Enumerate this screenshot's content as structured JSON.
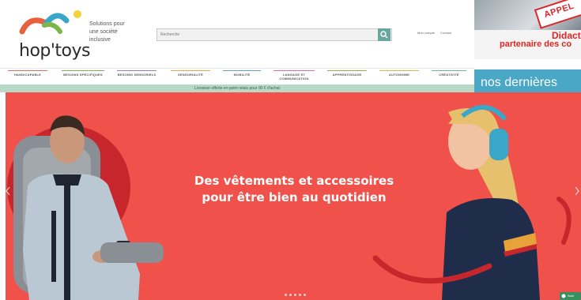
{
  "brand": {
    "logo_text": "hop'toys",
    "tagline": [
      "Solutions pour",
      "une société",
      "inclusive"
    ]
  },
  "search": {
    "placeholder": "Recherche"
  },
  "top_links": [
    "Mon compte",
    "Contact"
  ],
  "nav": {
    "items": [
      {
        "label": "HANDICAPABLE",
        "color": "#e66d5a"
      },
      {
        "label": "BESOINS SPÉCIFIQUES",
        "color": "#7fb35a"
      },
      {
        "label": "BESOINS SENSORIELS",
        "color": "#9e7cc1"
      },
      {
        "label": "SENSORIALITÉ",
        "color": "#e8a54b"
      },
      {
        "label": "MOBILITÉ",
        "color": "#5aa8c9"
      },
      {
        "label": "LANGAGE ET COMMUNICATION",
        "color": "#e66d8d"
      },
      {
        "label": "APPRENTISSAGE",
        "color": "#8fb54a"
      },
      {
        "label": "AUTONOMIE",
        "color": "#d9b64a"
      },
      {
        "label": "CRÉATIVITÉ",
        "color": "#6fb6a6"
      }
    ]
  },
  "promo": {
    "text": "Livraison offerte en point relais pour 90 € d'achat"
  },
  "ad": {
    "sign": "APPEL",
    "title_line1": "Didacto",
    "title_line2": "partenaire des co"
  },
  "right_banner": {
    "text": "nos dernières"
  },
  "hero": {
    "headline_line1": "Des vêtements et accessoires",
    "headline_line2": "pour être bien  au quotidien",
    "background": "#f0514a",
    "active_slide": 1,
    "slide_count": 5
  },
  "chat": {
    "label": "Aide"
  },
  "colors": {
    "accent": "#6aa6a0",
    "promo": "#b9d9c8",
    "brand_red": "#e3241f",
    "brand_blue": "#4aa7c6"
  }
}
